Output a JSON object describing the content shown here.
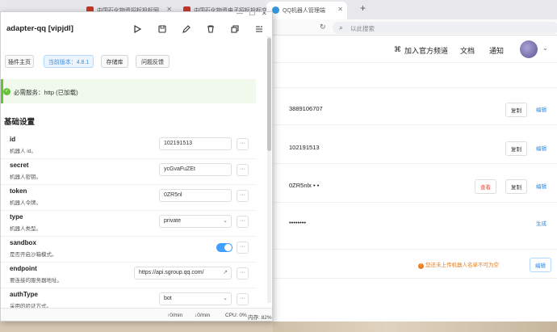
{
  "browser": {
    "tabs": [
      {
        "label": "中国石化物资招标投标网"
      },
      {
        "label": "中国石化物资电子招标投标交易"
      },
      {
        "label": "QQ机器人管理端"
      }
    ],
    "search_placeholder": "以此搜索",
    "new_tab": "+"
  },
  "page": {
    "nav": {
      "channel": "加入官方频道",
      "docs": "文档",
      "notify": "通知"
    },
    "rows": [
      {
        "value": "3889106707",
        "copy": "复制",
        "edit": "编辑"
      },
      {
        "value": "102191513",
        "copy": "复制",
        "edit": "编辑"
      },
      {
        "value": "0ZR5nlx • •",
        "view": "查看",
        "copy": "复制",
        "edit": "编辑"
      },
      {
        "value": "••••••••",
        "gen": "生成"
      }
    ],
    "warning": "您还未上传机器人名单不可为空",
    "edit_btn": "编辑"
  },
  "panel": {
    "title": "adapter-qq [vipjdl]",
    "tags": {
      "plugin_home": "插件主页",
      "version": "当前版本：4.8.1",
      "repo": "存储库",
      "feedback": "问题反馈"
    },
    "service": "必需服务：http (已加载)",
    "section": "基础设置",
    "settings": [
      {
        "key": "id",
        "desc": "机器人 id。",
        "value": "102191513"
      },
      {
        "key": "secret",
        "desc": "机器人密钥。",
        "value": "ycGvaFuZEt         "
      },
      {
        "key": "token",
        "desc": "机器人令牌。",
        "value": "0ZR5nl          "
      },
      {
        "key": "type",
        "desc": "机器人类型。",
        "value": "private"
      },
      {
        "key": "sandbox",
        "desc": "是否开启沙箱模式。",
        "value": "on"
      },
      {
        "key": "endpoint",
        "desc": "要连接的服务器地址。",
        "value": "https://api.sgroup.qq.com/"
      },
      {
        "key": "authType",
        "desc": "采用的验证方式。",
        "value": "bot"
      }
    ],
    "more_label": "···",
    "status": {
      "up": "0/min",
      "down": "0/min",
      "cpu": "CPU: 0%",
      "mem": "内存: 82%"
    }
  }
}
